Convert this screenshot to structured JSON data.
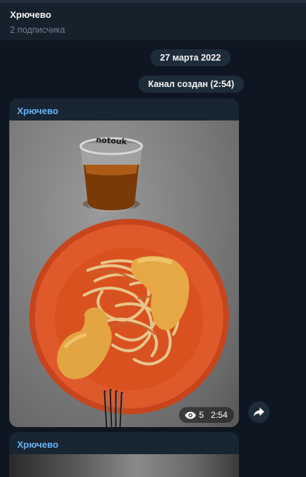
{
  "header": {
    "title": "Хрючево",
    "subtitle": "2 подписчика"
  },
  "messages": {
    "date_separator": "27 марта 2022",
    "service_message": "Канал создан (2:54)"
  },
  "posts": [
    {
      "author": "Хрючево",
      "views": "5",
      "time": "2:54",
      "photo_description": "plate of pasta with breaded cutlets and a glass of tea"
    },
    {
      "author": "Хрючево"
    }
  ],
  "icons": {
    "views": "eye-icon",
    "share": "share-arrow-icon"
  },
  "colors": {
    "background": "#0e1621",
    "header": "#17212b",
    "bubble": "#182533",
    "author": "#6ab3f3",
    "pill": "#1e2c3a",
    "plate": "#e05a2a"
  }
}
